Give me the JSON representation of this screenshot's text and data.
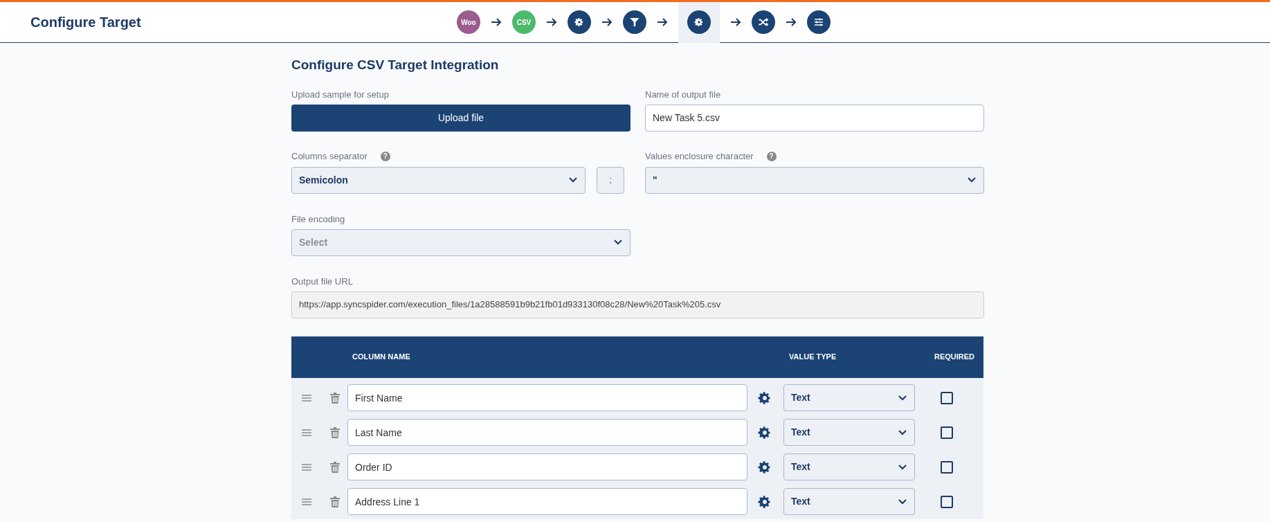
{
  "header": {
    "title": "Configure Target"
  },
  "steps": [
    {
      "kind": "woo",
      "label": "Woo",
      "selected": false
    },
    {
      "kind": "csv",
      "label": "CSV",
      "selected": false
    },
    {
      "kind": "gear",
      "selected": false
    },
    {
      "kind": "filter",
      "selected": false
    },
    {
      "kind": "gear",
      "selected": true
    },
    {
      "kind": "shuffle",
      "selected": false
    },
    {
      "kind": "sliders",
      "selected": false
    }
  ],
  "form": {
    "title": "Configure CSV Target Integration",
    "upload": {
      "label": "Upload sample for setup",
      "button": "Upload file"
    },
    "output_name": {
      "label": "Name of output file",
      "value": "New Task 5.csv"
    },
    "separator": {
      "label": "Columns separator",
      "help": "?",
      "value": "Semicolon",
      "char": ";"
    },
    "enclosure": {
      "label": "Values enclosure character",
      "help": "?",
      "value": "\""
    },
    "encoding": {
      "label": "File encoding",
      "placeholder": "Select"
    },
    "url": {
      "label": "Output file URL",
      "value": "https://app.syncspider.com/execution_files/1a28588591b9b21fb01d933130f08c28/New%20Task%205.csv"
    }
  },
  "table": {
    "columns": [
      "COLUMN NAME",
      "VALUE TYPE",
      "REQUIRED"
    ],
    "rows": [
      {
        "name": "First Name",
        "type": "Text",
        "required": false
      },
      {
        "name": "Last Name",
        "type": "Text",
        "required": false
      },
      {
        "name": "Order ID",
        "type": "Text",
        "required": false
      },
      {
        "name": "Address Line 1",
        "type": "Text",
        "required": false
      }
    ]
  }
}
